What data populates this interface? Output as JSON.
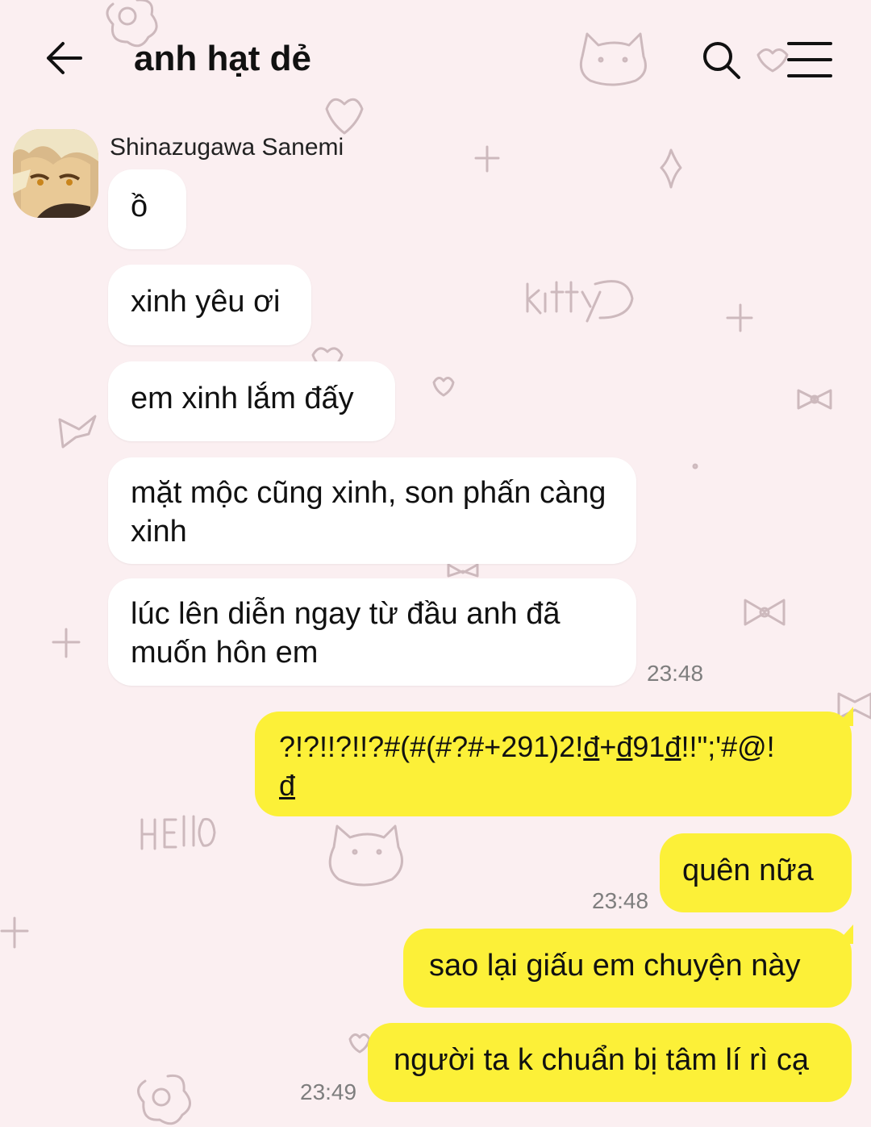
{
  "header": {
    "title": "anh hạt dẻ",
    "back_icon": "arrow-left-icon",
    "search_icon": "search-icon",
    "menu_icon": "hamburger-menu-icon"
  },
  "sender": {
    "name": "Shinazugawa Sanemi",
    "avatar": "avatar"
  },
  "messages": {
    "m1": "ồ",
    "m2": "xinh yêu ơi",
    "m3": "em xinh lắm đấy",
    "m4": "mặt mộc cũng xinh, son phấn càng xinh",
    "m5": "lúc lên diễn ngay từ đầu anh đã muốn hôn em",
    "t1": "23:48",
    "m6_part1": "?!?!!?!!?#(#(#?#+291)2!",
    "m6_part2": "đ",
    "m6_part3": "+",
    "m6_part4": "đ",
    "m6_part5": "91",
    "m6_part6": "đ",
    "m6_part7": "!!\";'#@!",
    "m6_part8": "đ",
    "m7": "quên nữa",
    "t2": "23:48",
    "m8": "sao lại giấu em chuyện này",
    "m9": "người ta k chuẩn bị tâm lí rì cạ",
    "t3": "23:49"
  },
  "colors": {
    "background": "#fbeff1",
    "incoming_bubble": "#ffffff",
    "outgoing_bubble": "#fcf038",
    "timestamp": "#7e7e7e",
    "doodle": "#c8b4b8"
  },
  "background_doodles": [
    "flower-icon",
    "cat-face-icon",
    "heart-icon",
    "sparkle-icon",
    "plus-icon",
    "bow-icon"
  ]
}
